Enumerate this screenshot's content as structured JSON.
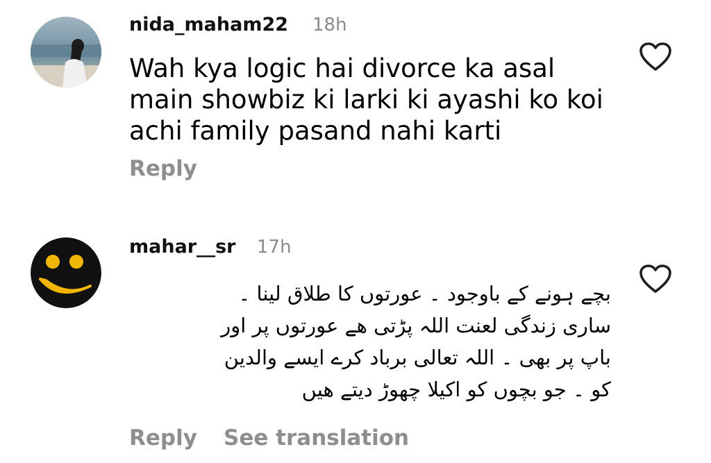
{
  "comments": [
    {
      "username": "nida_maham22",
      "time": "18h",
      "text_lines": [
        "Wah kya logic hai divorce ka asal",
        "main showbiz ki larki ki ayashi ko koi",
        "achi family pasand nahi karti"
      ],
      "reply_label": "Reply",
      "like_icon": "heart-outline-icon",
      "avatar_icon": "profile-photo-beach"
    },
    {
      "username": "mahar__sr",
      "time": "17h",
      "text_lines": [
        "بچے ہونے کے باوجود ۔ عورتوں کا طلاق لینا ۔",
        "ساری زندگی لعنت اللہ پڑتی ھے عورتوں پر اور",
        "باپ پر بھی ۔ اللہ تعالی برباد کرے ایسے والدین",
        "کو ۔ جو بچوں کو اکیلا چھوڑ دیتے ھیں"
      ],
      "reply_label": "Reply",
      "translate_label": "See translation",
      "like_icon": "heart-outline-icon",
      "avatar_icon": "smiley-face-avatar"
    }
  ],
  "colors": {
    "text": "#000000",
    "muted": "#8e8e8e",
    "smiley_bg": "#111111",
    "smiley_accent": "#f2b705"
  }
}
